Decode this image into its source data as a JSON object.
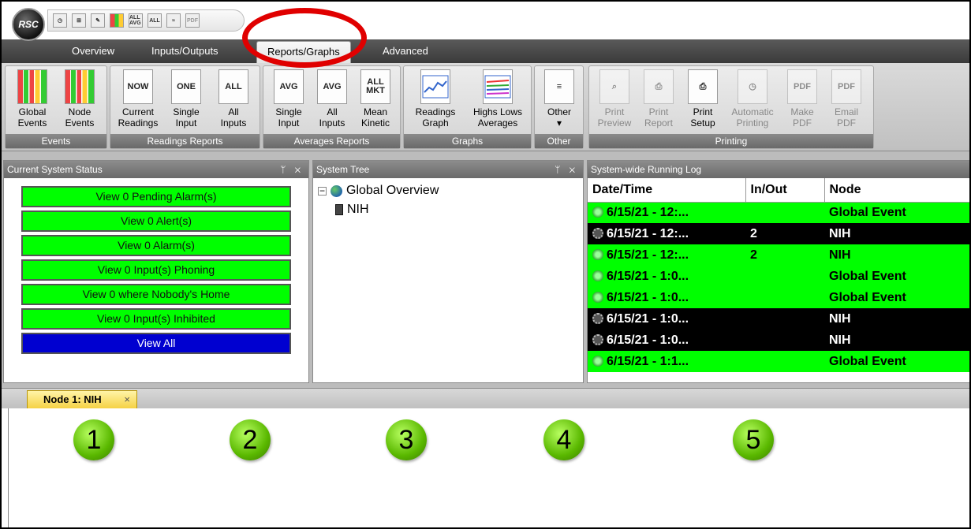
{
  "app": {
    "logo": "RSC"
  },
  "quick_access": [
    "clock-icon",
    "tree-icon",
    "edit-icon",
    "bars-icon",
    "all-avg-icon",
    "all-icon",
    "graph-icon",
    "pdf-icon"
  ],
  "quick_labels": {
    "all_avg": "ALL AVG",
    "all": "ALL",
    "pdf": "PDF"
  },
  "ribbon_tabs": [
    "Overview",
    "Inputs/Outputs",
    "Reports/Graphs",
    "Advanced"
  ],
  "active_tab": "Reports/Graphs",
  "groups": {
    "events": {
      "caption": "Events",
      "buttons": [
        {
          "l1": "Global",
          "l2": "Events"
        },
        {
          "l1": "Node",
          "l2": "Events"
        }
      ]
    },
    "readings": {
      "caption": "Readings Reports",
      "buttons": [
        {
          "icon": "NOW",
          "l1": "Current",
          "l2": "Readings"
        },
        {
          "icon": "ONE",
          "l1": "Single",
          "l2": "Input"
        },
        {
          "icon": "ALL",
          "l1": "All",
          "l2": "Inputs"
        }
      ]
    },
    "averages": {
      "caption": "Averages Reports",
      "buttons": [
        {
          "icon": "AVG",
          "l1": "Single",
          "l2": "Input"
        },
        {
          "icon": "AVG",
          "l1": "All",
          "l2": "Inputs"
        },
        {
          "icon": "ALL MKT",
          "l1": "Mean",
          "l2": "Kinetic"
        }
      ]
    },
    "graphs": {
      "caption": "Graphs",
      "buttons": [
        {
          "l1": "Readings",
          "l2": "Graph"
        },
        {
          "l1": "Highs Lows",
          "l2": "Averages"
        }
      ]
    },
    "other": {
      "caption": "Other",
      "buttons": [
        {
          "l1": "Other",
          "l2": "▾"
        }
      ]
    },
    "printing": {
      "caption": "Printing",
      "buttons": [
        {
          "l1": "Print",
          "l2": "Preview"
        },
        {
          "l1": "Print",
          "l2": "Report"
        },
        {
          "l1": "Print",
          "l2": "Setup"
        },
        {
          "l1": "Automatic",
          "l2": "Printing"
        },
        {
          "l1": "Make",
          "l2": "PDF",
          "icon": "PDF"
        },
        {
          "l1": "Email",
          "l2": "PDF",
          "icon": "PDF"
        }
      ]
    }
  },
  "status_panel": {
    "title": "Current System Status",
    "buttons": [
      "View 0 Pending Alarm(s)",
      "View 0 Alert(s)",
      "View 0 Alarm(s)",
      "View 0 Input(s) Phoning",
      "View 0 where Nobody's Home",
      "View 0 Input(s) Inhibited",
      "View All"
    ]
  },
  "tree_panel": {
    "title": "System Tree",
    "root": "Global Overview",
    "child": "NIH"
  },
  "log_panel": {
    "title": "System-wide Running Log",
    "columns": [
      "Date/Time",
      "In/Out",
      "Node"
    ],
    "rows": [
      {
        "date": "6/15/21 - 12:...",
        "io": "",
        "node": "Global Event",
        "style": "green",
        "icon": "check-icon"
      },
      {
        "date": "6/15/21 - 12:...",
        "io": "2",
        "node": "NIH",
        "style": "black",
        "icon": "gear-icon"
      },
      {
        "date": "6/15/21 - 12:...",
        "io": "2",
        "node": "NIH",
        "style": "green",
        "icon": "check-icon"
      },
      {
        "date": "6/15/21 - 1:0...",
        "io": "",
        "node": "Global Event",
        "style": "green",
        "icon": "check-icon"
      },
      {
        "date": "6/15/21 - 1:0...",
        "io": "",
        "node": "Global Event",
        "style": "green",
        "icon": "check-icon"
      },
      {
        "date": "6/15/21 - 1:0...",
        "io": "",
        "node": "NIH",
        "style": "black",
        "icon": "gear-icon"
      },
      {
        "date": "6/15/21 - 1:0...",
        "io": "",
        "node": "NIH",
        "style": "black",
        "icon": "gear-icon"
      },
      {
        "date": "6/15/21 - 1:1...",
        "io": "",
        "node": "Global Event",
        "style": "green",
        "icon": "check-icon"
      }
    ]
  },
  "doc_tab": {
    "label": "Node 1: NIH",
    "close": "×"
  },
  "panel_controls": "ᛘ ✕",
  "callouts": [
    "1",
    "2",
    "3",
    "4",
    "5"
  ],
  "colors": {
    "ok": "#00ff00",
    "view_all": "#0000d0",
    "highlight": "#e00000"
  }
}
